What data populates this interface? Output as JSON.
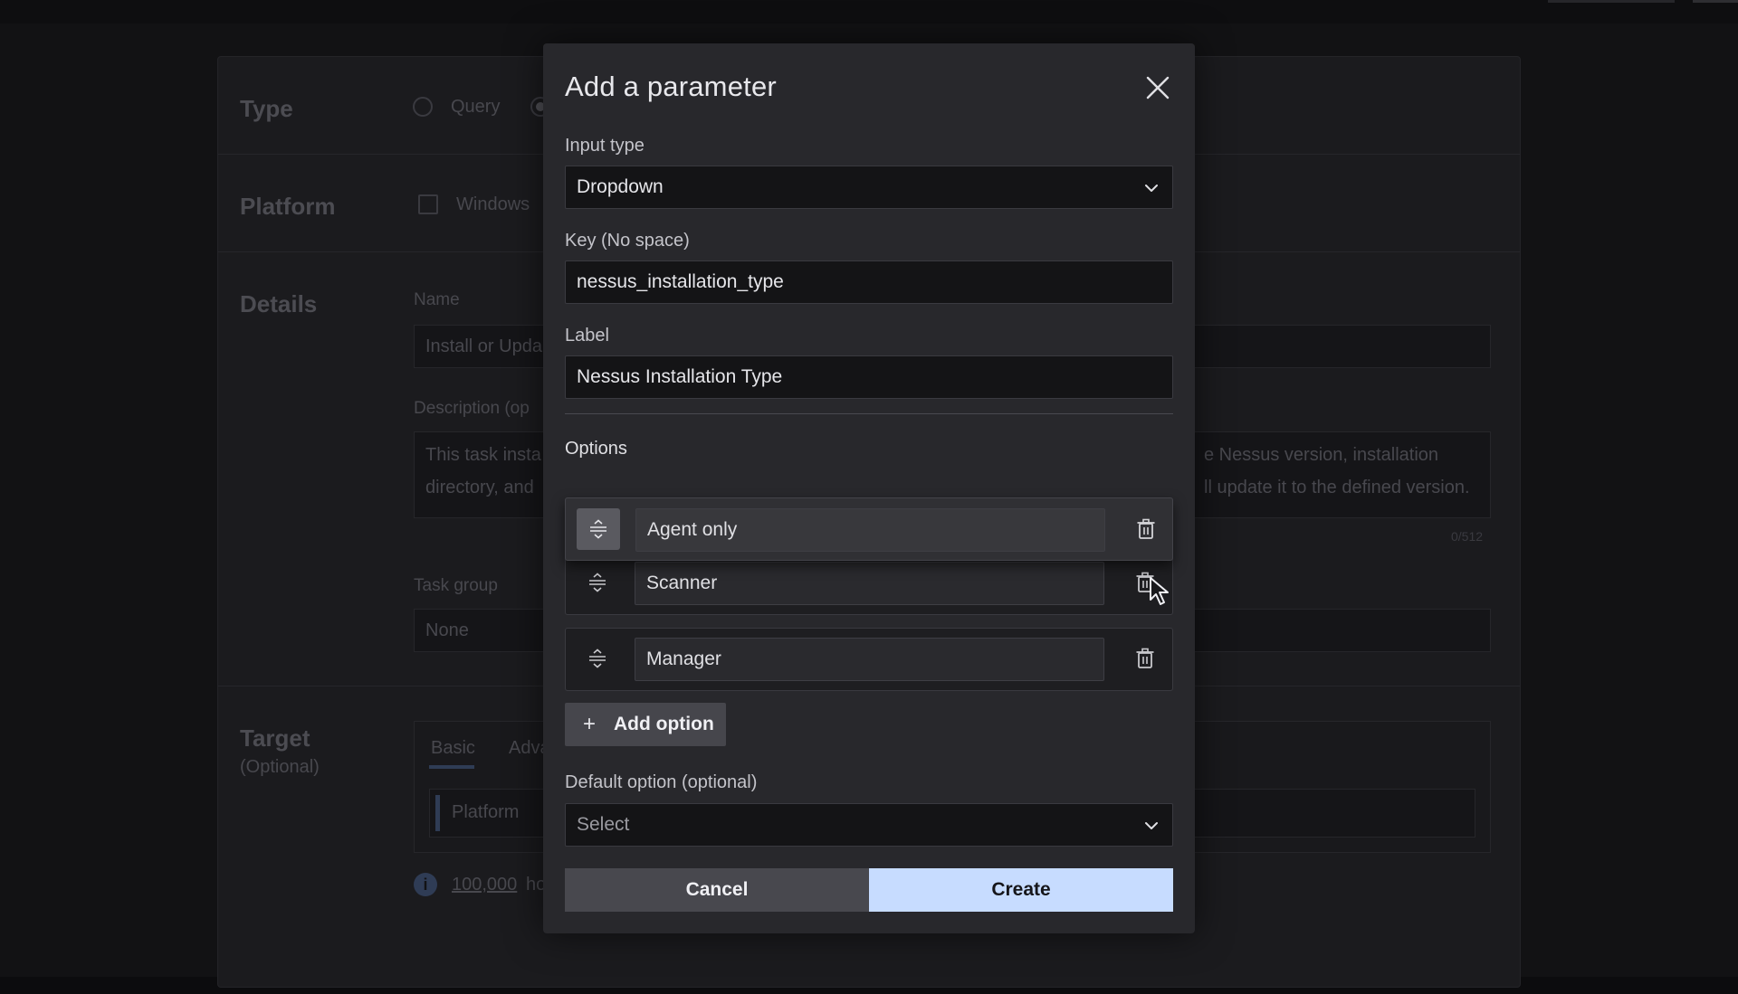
{
  "background": {
    "type_section": {
      "title": "Type",
      "option_query": "Query"
    },
    "platform_section": {
      "title": "Platform",
      "option_windows": "Windows"
    },
    "details_section": {
      "title": "Details",
      "name_label": "Name",
      "name_value": "Install or Upda",
      "description_label": "Description (op",
      "description_line1_left": "This task insta",
      "description_line2_left": "directory, and",
      "description_line1_right": "e Nessus version, installation",
      "description_line2_right": "ll update it to the defined version.",
      "char_count": "0/512",
      "task_group_label": "Task group",
      "task_group_value": "None"
    },
    "target_section": {
      "title": "Target",
      "subtitle": "(Optional)",
      "tab_basic": "Basic",
      "tab_advanced": "Adva",
      "platform_chip": "Platform",
      "hosts_count": "100,000",
      "hosts_suffix": "ho"
    }
  },
  "modal": {
    "title": "Add a parameter",
    "input_type": {
      "label": "Input type",
      "value": "Dropdown"
    },
    "key": {
      "label": "Key (No space)",
      "value": "nessus_installation_type"
    },
    "label_field": {
      "label": "Label",
      "value": "Nessus Installation Type"
    },
    "options_heading": "Options",
    "options": [
      {
        "value": "Agent only"
      },
      {
        "value": "Scanner"
      },
      {
        "value": "Manager"
      }
    ],
    "add_option_label": "Add option",
    "default_option": {
      "label": "Default option (optional)",
      "placeholder": "Select"
    },
    "cancel_label": "Cancel",
    "create_label": "Create"
  }
}
